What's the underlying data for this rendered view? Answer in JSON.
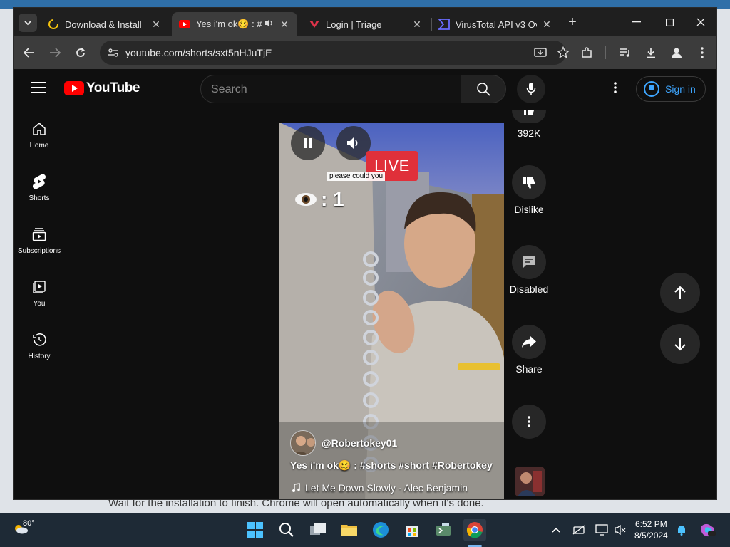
{
  "browser": {
    "tabs": [
      {
        "title": "Download & Install",
        "active": false
      },
      {
        "title": "Yes i'm ok🥴 : #s",
        "active": true
      },
      {
        "title": "Login | Triage",
        "active": false
      },
      {
        "title": "VirusTotal API v3 Ove",
        "active": false
      }
    ],
    "url": "youtube.com/shorts/sxt5nHJuTjE"
  },
  "youtube": {
    "logo_text": "YouTube",
    "search_placeholder": "Search",
    "sign_in": "Sign in",
    "sidebar": [
      {
        "label": "Home",
        "icon": "home-icon"
      },
      {
        "label": "Shorts",
        "icon": "shorts-icon"
      },
      {
        "label": "Subscriptions",
        "icon": "subscriptions-icon"
      },
      {
        "label": "You",
        "icon": "you-icon"
      },
      {
        "label": "History",
        "icon": "history-icon"
      }
    ],
    "short": {
      "live_badge": "LIVE",
      "caption": "please could you",
      "viewers": ": 1",
      "channel": "@Robertokey01",
      "title": "Yes i'm ok🥴 : #shorts #short #Robertokey",
      "music": "Let Me Down Slowly · Alec Benjamin"
    },
    "actions": {
      "likes": "392K",
      "dislike": "Dislike",
      "comments": "Disabled",
      "share": "Share"
    }
  },
  "background_page": {
    "text": "Wait for the installation to finish. Chrome will open automatically when it's done."
  },
  "taskbar": {
    "weather_temp": "80°",
    "time": "6:52 PM",
    "date": "8/5/2024"
  }
}
